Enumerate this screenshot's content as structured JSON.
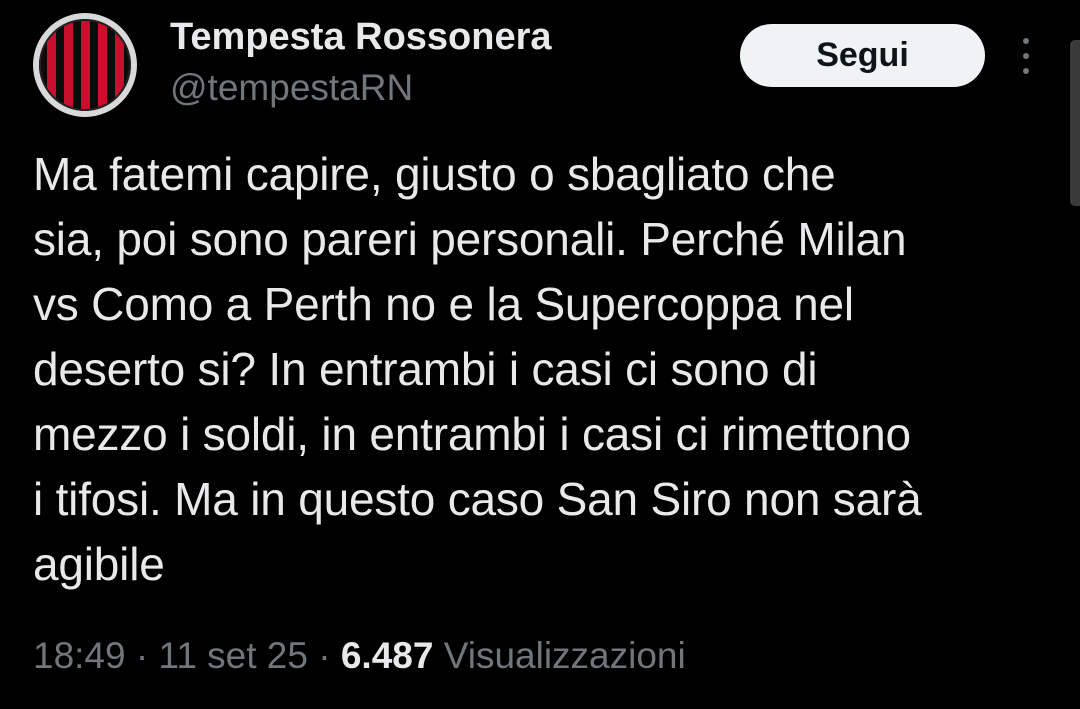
{
  "author": {
    "display_name": "Tempesta Rossonera",
    "handle": "@tempestaRN",
    "avatar_icon": "red-black-striped-logo"
  },
  "follow_button": {
    "label": "Segui"
  },
  "tweet": {
    "text": "Ma fatemi capire, giusto o sbagliato che\nsia, poi sono pareri personali. Perché Milan\nvs Como a Perth no e la Supercoppa nel\ndeserto si? In entrambi i casi ci sono di\nmezzo i soldi, in entrambi i casi ci rimettono\ni tifosi. Ma in questo caso San Siro non sarà\nagibile"
  },
  "meta": {
    "time": "18:49",
    "separator": " · ",
    "date": "11 set 25",
    "views_count": "6.487",
    "views_label": " Visualizzazioni"
  },
  "colors": {
    "background": "#000000",
    "primary_text": "#e7e9ea",
    "secondary_text": "#71767b",
    "button_bg": "#eff3f4",
    "logo_red": "#c8102e"
  }
}
